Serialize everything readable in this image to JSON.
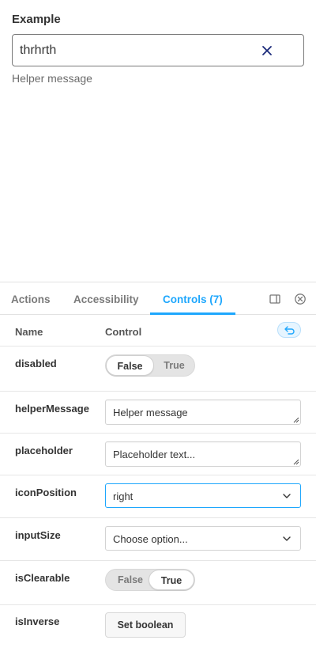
{
  "preview": {
    "label": "Example",
    "input_value": "thrhrth",
    "helper": "Helper message",
    "clear_icon": "close-icon"
  },
  "tabs": [
    {
      "label": "Actions",
      "active": false
    },
    {
      "label": "Accessibility",
      "active": false
    },
    {
      "label": "Controls (7)",
      "active": true
    }
  ],
  "tab_icons": [
    "panel-layout-icon",
    "close-circle-icon"
  ],
  "table": {
    "col_name": "Name",
    "col_control": "Control",
    "reset_icon": "undo-icon"
  },
  "controls": {
    "disabled": {
      "name": "disabled",
      "false_label": "False",
      "true_label": "True",
      "value": false
    },
    "helperMessage": {
      "name": "helperMessage",
      "value": "Helper message"
    },
    "placeholder": {
      "name": "placeholder",
      "value": "Placeholder text..."
    },
    "iconPosition": {
      "name": "iconPosition",
      "value": "right"
    },
    "inputSize": {
      "name": "inputSize",
      "value": "Choose option..."
    },
    "isClearable": {
      "name": "isClearable",
      "false_label": "False",
      "true_label": "True",
      "value": true
    },
    "isInverse": {
      "name": "isInverse",
      "button": "Set boolean"
    }
  },
  "colors": {
    "accent": "#1ea7fd",
    "clear_icon": "#1b2a7a"
  }
}
